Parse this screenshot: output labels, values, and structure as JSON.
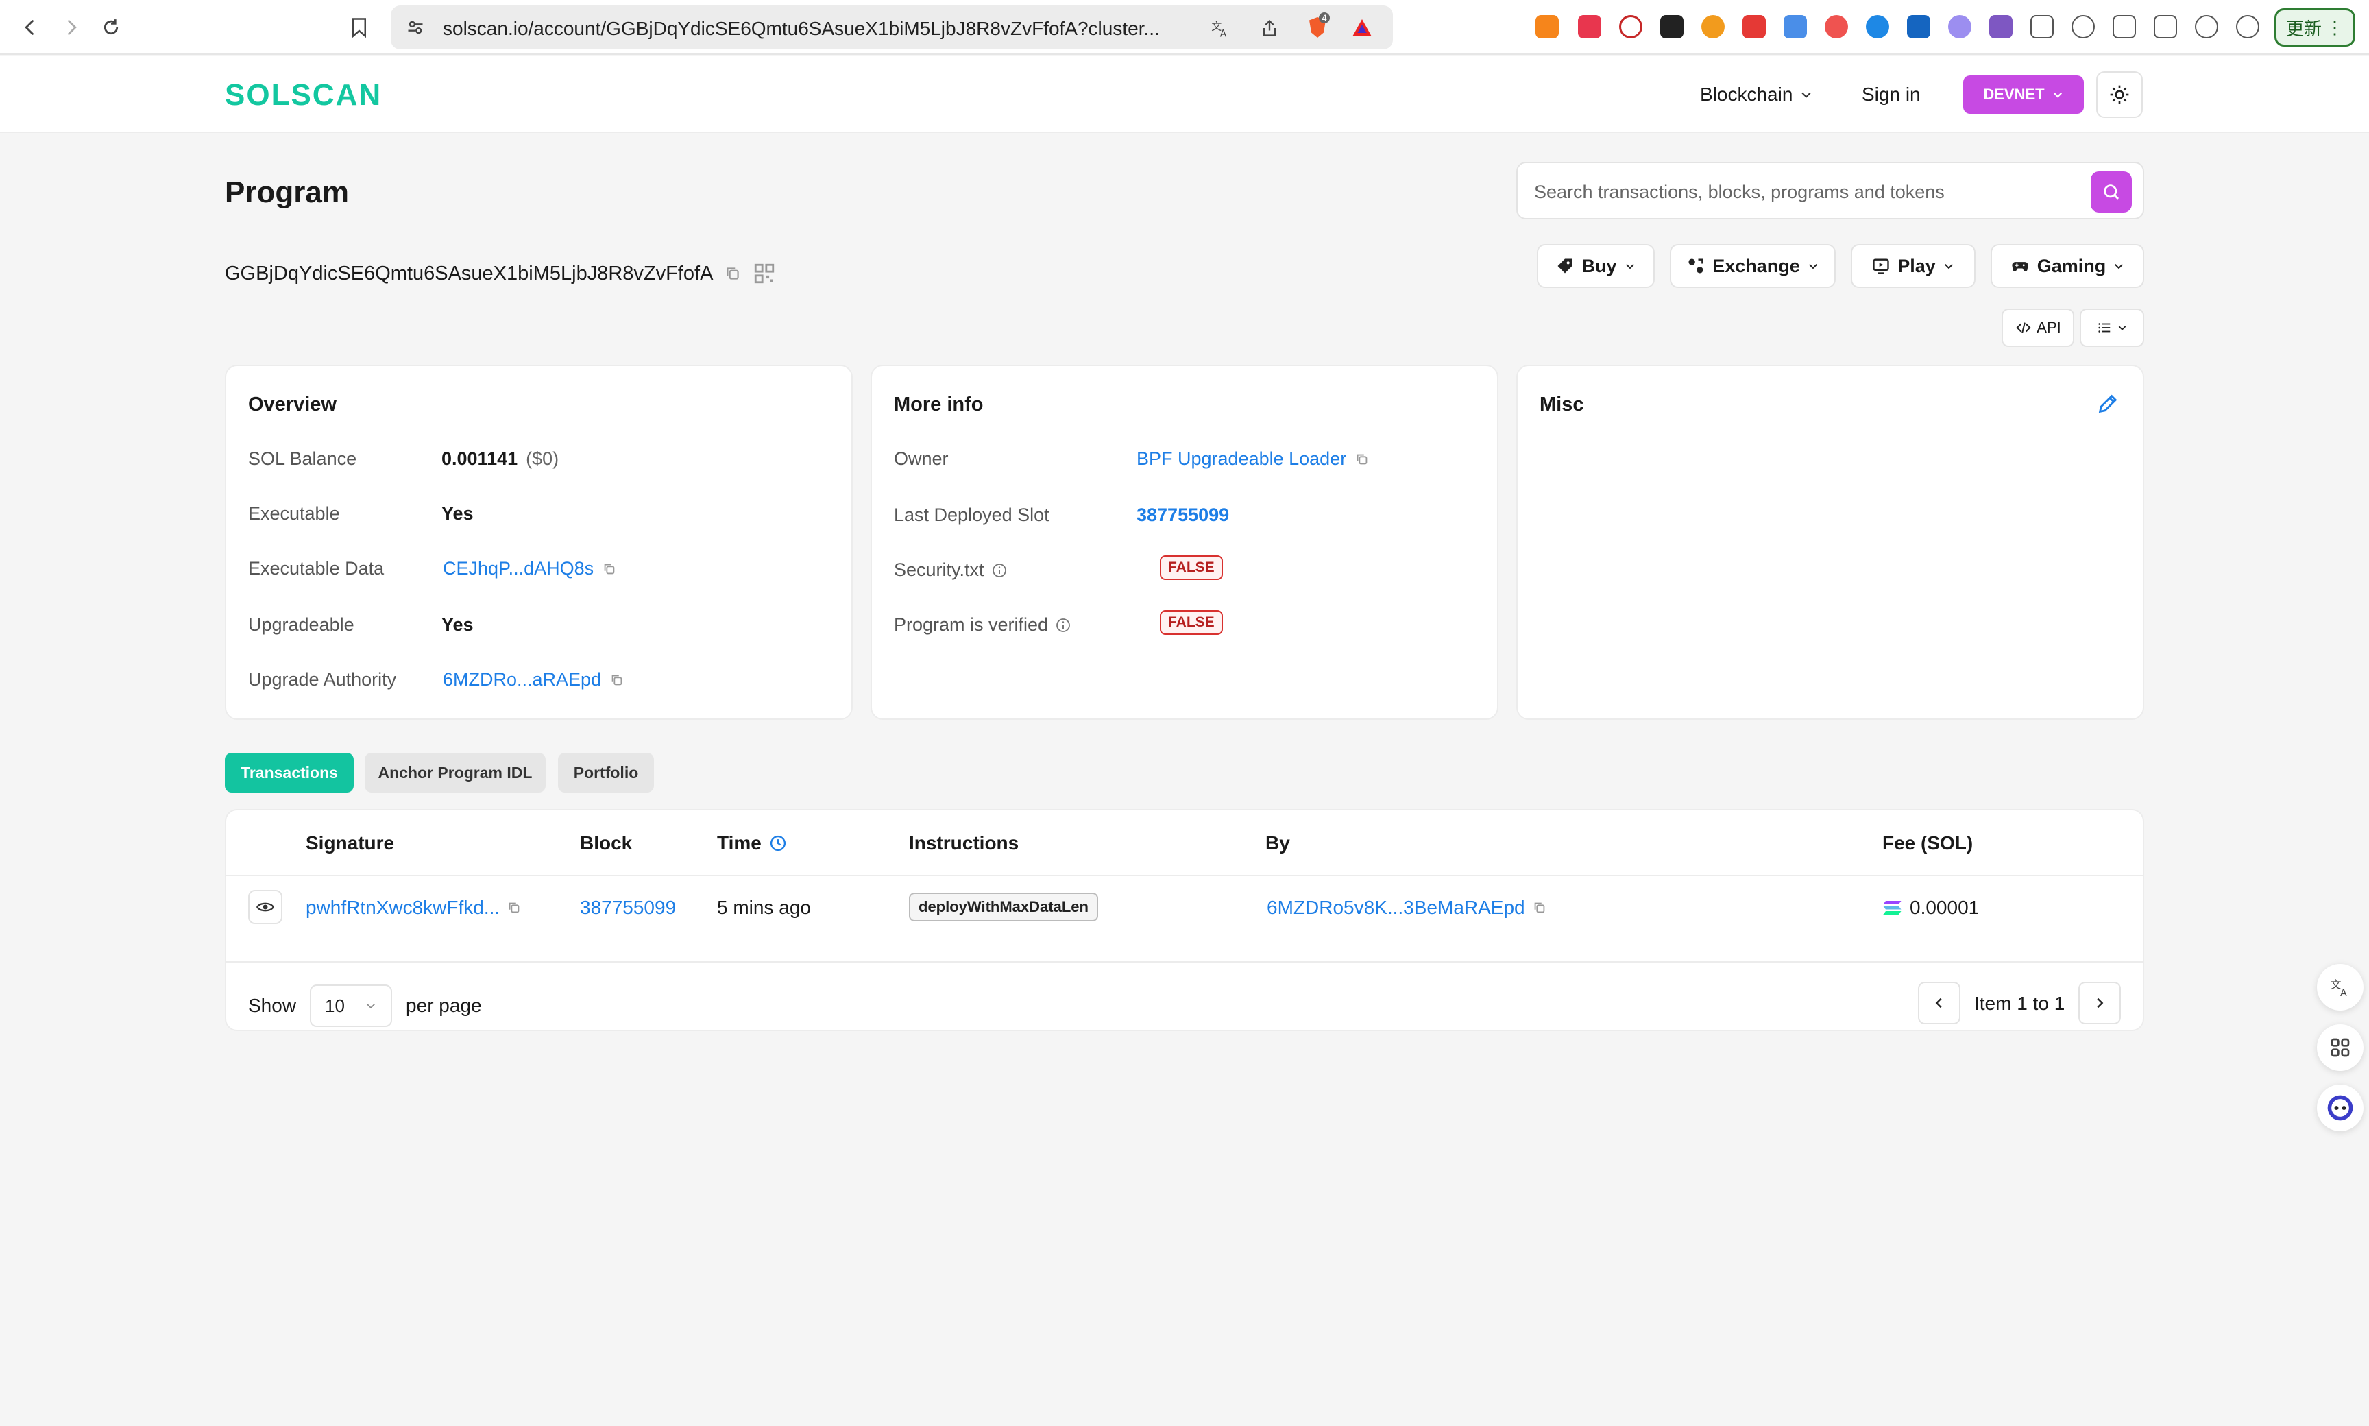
{
  "browser": {
    "url": "solscan.io/account/GGBjDqYdicSE6Qmtu6SAsueX1biM5LjbJ8R8vZvFfofA?cluster...",
    "shield_count": "4",
    "update_label": "更新"
  },
  "header": {
    "logo": "SOLSCAN",
    "blockchain_label": "Blockchain",
    "signin_label": "Sign in",
    "network_label": "DEVNET"
  },
  "page": {
    "title": "Program",
    "address": "GGBjDqYdicSE6Qmtu6SAsueX1biM5LjbJ8R8vZvFfofA",
    "search_placeholder": "Search transactions, blocks, programs and tokens",
    "pills": {
      "buy": "Buy",
      "exchange": "Exchange",
      "play": "Play",
      "gaming": "Gaming"
    },
    "api_label": "API"
  },
  "overview": {
    "title": "Overview",
    "sol_balance_label": "SOL Balance",
    "sol_balance_value": "0.001141",
    "sol_balance_usd": "($0)",
    "executable_label": "Executable",
    "executable_value": "Yes",
    "executable_data_label": "Executable Data",
    "executable_data_value": "CEJhqP...dAHQ8s",
    "upgradeable_label": "Upgradeable",
    "upgradeable_value": "Yes",
    "upgrade_authority_label": "Upgrade Authority",
    "upgrade_authority_value": "6MZDRo...aRAEpd"
  },
  "more_info": {
    "title": "More info",
    "owner_label": "Owner",
    "owner_value": "BPF Upgradeable Loader",
    "slot_label": "Last Deployed Slot",
    "slot_value": "387755099",
    "security_label": "Security.txt",
    "security_value": "FALSE",
    "verified_label": "Program is verified",
    "verified_value": "FALSE"
  },
  "misc": {
    "title": "Misc"
  },
  "tabs": {
    "transactions": "Transactions",
    "idl": "Anchor Program IDL",
    "portfolio": "Portfolio"
  },
  "table": {
    "headers": {
      "signature": "Signature",
      "block": "Block",
      "time": "Time",
      "instructions": "Instructions",
      "by": "By",
      "fee": "Fee (SOL)"
    },
    "rows": [
      {
        "signature": "pwhfRtnXwc8kwFfkd...",
        "block": "387755099",
        "time": "5 mins ago",
        "instruction": "deployWithMaxDataLen",
        "by": "6MZDRo5v8K...3BeMaRAEpd",
        "fee": "0.00001"
      }
    ],
    "show_label": "Show",
    "per_page_value": "10",
    "per_page_label": "per page",
    "pagination_text": "Item 1 to 1"
  }
}
